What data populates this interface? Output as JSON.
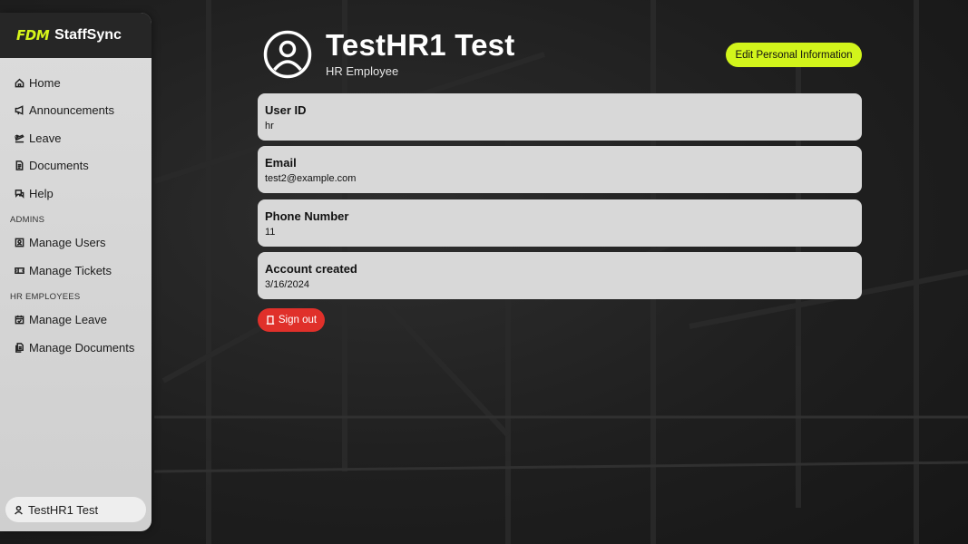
{
  "brand": {
    "logo": "FDM",
    "name": "StaffSync"
  },
  "sidebar": {
    "items": [
      {
        "label": "Home",
        "icon": "home-icon"
      },
      {
        "label": "Announcements",
        "icon": "megaphone-icon"
      },
      {
        "label": "Leave",
        "icon": "plane-icon"
      },
      {
        "label": "Documents",
        "icon": "document-icon"
      },
      {
        "label": "Help",
        "icon": "help-chat-icon"
      }
    ],
    "admins_label": "ADMINS",
    "admin_items": [
      {
        "label": "Manage Users",
        "icon": "user-card-icon"
      },
      {
        "label": "Manage Tickets",
        "icon": "ticket-icon"
      }
    ],
    "hr_label": "HR EMPLOYEES",
    "hr_items": [
      {
        "label": "Manage Leave",
        "icon": "calendar-icon"
      },
      {
        "label": "Manage Documents",
        "icon": "files-icon"
      }
    ],
    "user_chip": "TestHR1 Test"
  },
  "profile": {
    "name": "TestHR1 Test",
    "role": "HR Employee",
    "edit_label": "Edit Personal Information",
    "fields": [
      {
        "label": "User ID",
        "value": "hr"
      },
      {
        "label": "Email",
        "value": "test2@example.com"
      },
      {
        "label": "Phone Number",
        "value": "11"
      },
      {
        "label": "Account created",
        "value": "3/16/2024"
      }
    ],
    "signout_label": "Sign out"
  },
  "colors": {
    "accent": "#d2f51b",
    "danger": "#e0302a",
    "sidebar": "#d4d4d4"
  }
}
